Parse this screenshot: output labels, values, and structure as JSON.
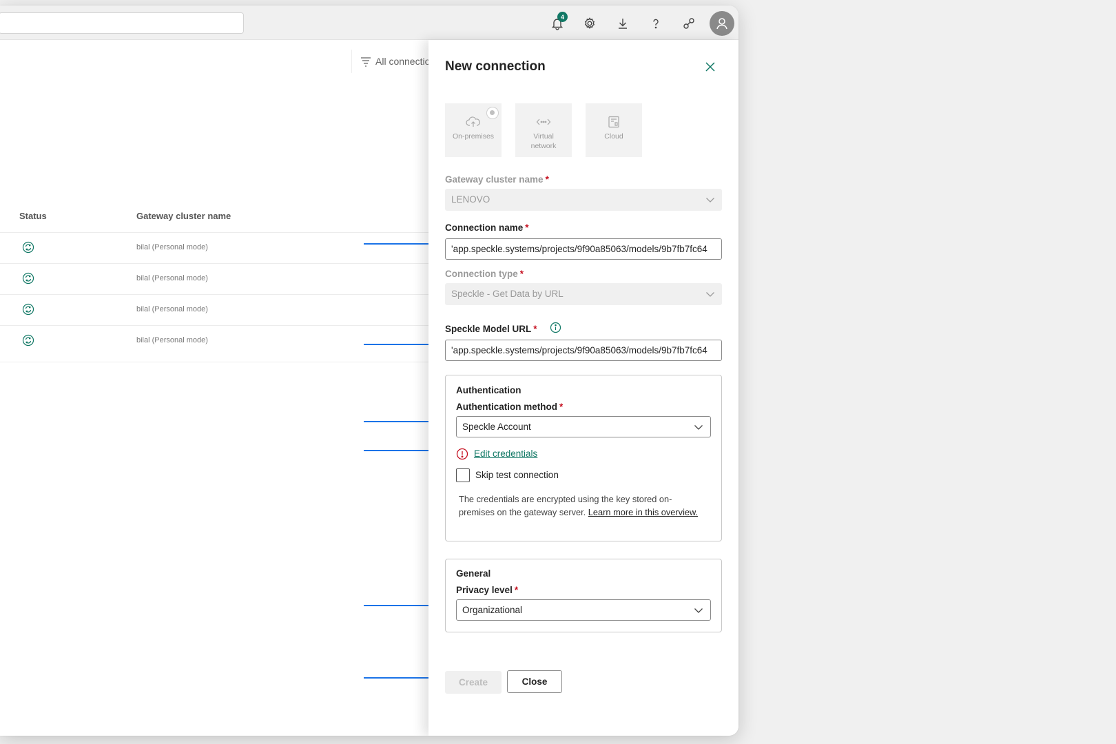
{
  "header": {
    "notification_count": "4",
    "search_value": ""
  },
  "list": {
    "filter_label": "All connectio",
    "columns": [
      "Status",
      "Gateway cluster name"
    ],
    "rows": [
      {
        "name": "bilal (Personal mode)"
      },
      {
        "name": "bilal (Personal mode)"
      },
      {
        "name": "bilal (Personal mode)"
      },
      {
        "name": "bilal (Personal mode)"
      }
    ]
  },
  "panel": {
    "title": "New connection",
    "tiles": [
      "On-premises",
      "Virtual network",
      "Cloud"
    ],
    "gateway_cluster_label": "Gateway cluster name",
    "gateway_cluster_value": "LENOVO",
    "connection_name_label": "Connection name",
    "connection_name_value": "'app.speckle.systems/projects/9f90a85063/models/9b7fb7fc64",
    "connection_type_label": "Connection type",
    "connection_type_value": "Speckle - Get Data by URL",
    "model_url_label": "Speckle Model URL",
    "model_url_value": "'app.speckle.systems/projects/9f90a85063/models/9b7fb7fc64",
    "required_mark": "*",
    "auth": {
      "section_title": "Authentication",
      "method_label": "Authentication method",
      "method_value": "Speckle Account",
      "edit_credentials": "Edit credentials",
      "skip_test": "Skip test connection",
      "note": "The credentials are encrypted using the key stored on-premises on the gateway server.",
      "note_link": "Learn more in this overview."
    },
    "general": {
      "section_title": "General",
      "privacy_label": "Privacy level",
      "privacy_value": "Organizational"
    },
    "create_label": "Create",
    "close_label": "Close"
  },
  "colors": {
    "accent": "#117865",
    "annotation": "#1a73e8",
    "required": "#c50f1f"
  }
}
